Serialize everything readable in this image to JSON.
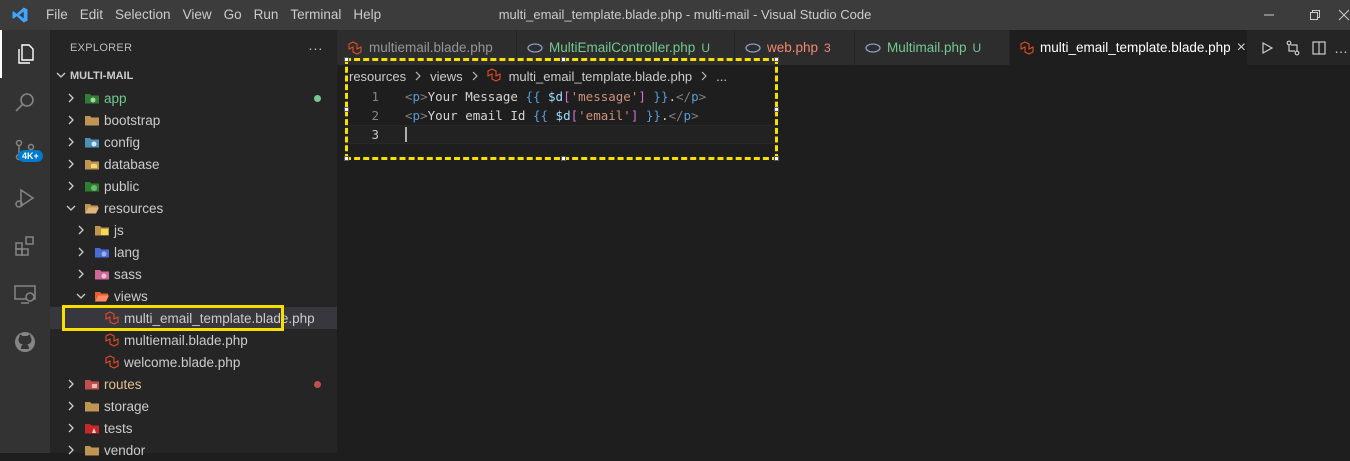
{
  "titlebar": {
    "menu": [
      "File",
      "Edit",
      "Selection",
      "View",
      "Go",
      "Run",
      "Terminal",
      "Help"
    ],
    "title": "multi_email_template.blade.php - multi-mail - Visual Studio Code"
  },
  "activity_badge": "4K+",
  "sidebar": {
    "header": "EXPLORER",
    "more": "···",
    "section": "MULTI-MAIL",
    "items": [
      {
        "label": "app",
        "color": "#73c991"
      },
      {
        "label": "bootstrap"
      },
      {
        "label": "config"
      },
      {
        "label": "database"
      },
      {
        "label": "public"
      },
      {
        "label": "resources"
      },
      {
        "label": "js"
      },
      {
        "label": "lang"
      },
      {
        "label": "sass"
      },
      {
        "label": "views"
      },
      {
        "label": "multi_email_template.blade.php"
      },
      {
        "label": "multiemail.blade.php"
      },
      {
        "label": "welcome.blade.php"
      },
      {
        "label": "routes",
        "color": "#e2c08d"
      },
      {
        "label": "storage"
      },
      {
        "label": "tests"
      },
      {
        "label": "vendor"
      }
    ]
  },
  "tabs": [
    {
      "label": "multiemail.blade.php",
      "status": ""
    },
    {
      "label": "MultiEmailController.php",
      "status": "U"
    },
    {
      "label": "web.php",
      "status": "3"
    },
    {
      "label": "Multimail.php",
      "status": "U"
    },
    {
      "label": "multi_email_template.blade.php",
      "status": "×"
    }
  ],
  "breadcrumb": [
    "resources",
    "views",
    "multi_email_template.blade.php",
    "..."
  ],
  "editor": {
    "line_numbers": [
      "1",
      "2",
      "3"
    ],
    "lines": [
      "<p>Your Message {{ $d['message'] }}.</p>",
      "<p>Your email Id {{ $d['email'] }}.</p>",
      ""
    ]
  },
  "colors": {
    "accent": "#f5e000",
    "modified": "#e2c08d",
    "untracked": "#73c991",
    "error": "#f48771"
  }
}
